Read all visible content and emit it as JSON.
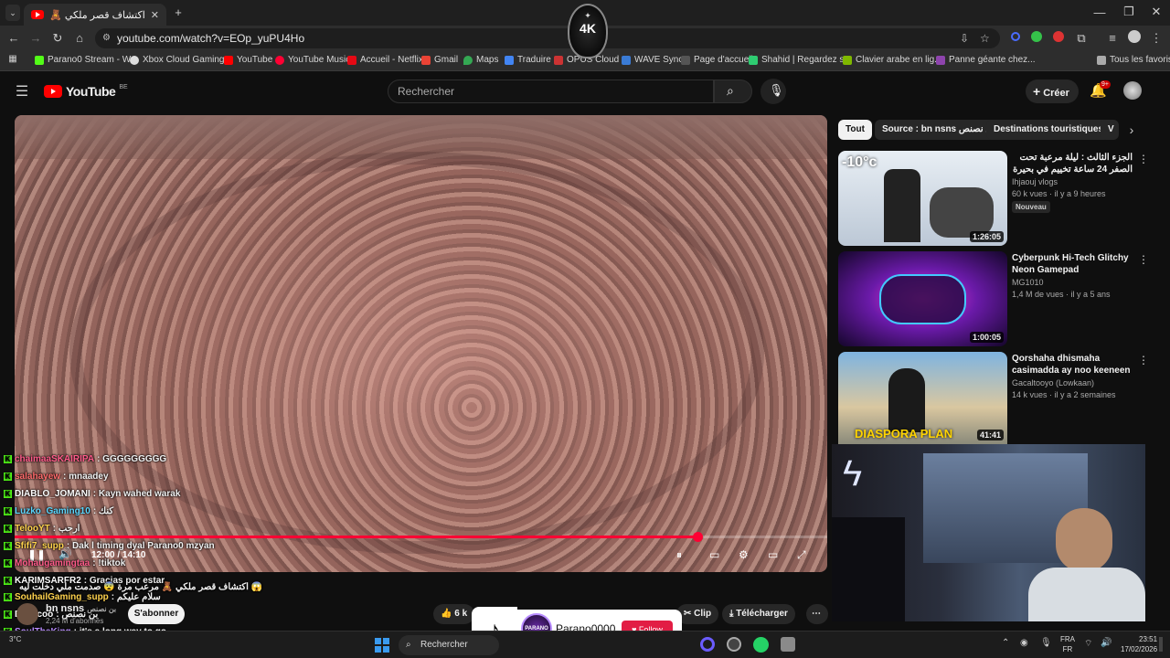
{
  "browser": {
    "tab_title": "اكتشاف قصر ملكي 🧸 (432) 🔊",
    "url": "youtube.com/watch?v=EOp_yuPU4Ho",
    "bookmarks": [
      "Parano0 Stream - W...",
      "Xbox Cloud Gaming...",
      "YouTube",
      "YouTube Music",
      "Accueil - Netflix",
      "Gmail",
      "Maps",
      "Traduire",
      "OPUS Cloud",
      "WAVE Sync",
      "Page d'accueil",
      "Shahid | Regardez s...",
      "Clavier arabe en lig...",
      "Panne géante chez..."
    ],
    "all_favorites": "Tous les favoris",
    "watermark": "4K"
  },
  "youtube": {
    "logo": "YouTube",
    "region": "BE",
    "search_placeholder": "Rechercher",
    "create_label": "Créer",
    "notif_count": "9+"
  },
  "player": {
    "progress": 0.84,
    "time": "12:00 / 14:10"
  },
  "chips": [
    "Tout",
    "Source : bn nsns بن نصنص",
    "Destinations touristiques",
    "V"
  ],
  "recommendations": [
    {
      "title": "الجزء الثالث : ليلة مرعبة تحت الصفر 24 ساعة تخييم في بحيرة صفيت ❄️",
      "channel": "Ihjaouj vlogs",
      "meta": "60 k vues · il y a 9 heures",
      "badge": "Nouveau",
      "duration": "1:26:05",
      "thumb_text": "-10°c"
    },
    {
      "title": "Cyberpunk Hi-Tech Glitchy Neon Gamepad Background ...",
      "channel": "MG1010",
      "meta": "1,4 M de vues · il y a 5 ans",
      "badge": "",
      "duration": "1:00:05",
      "thumb_text": ""
    },
    {
      "title": "Qorshaha dhismaha casimadda ay noo keeneen ...",
      "channel": "Gacaltooyo (Lowkaan)",
      "meta": "14 k vues · il y a 2 semaines",
      "badge": "",
      "duration": "41:41",
      "thumb_text": "DIASPORA PLAN"
    }
  ],
  "chat": [
    {
      "user": "chaimaaSKAIRIPA",
      "msg": ": GGGGGGGGG",
      "color": "#ff5b8a"
    },
    {
      "user": "salahayew",
      "msg": ": mnaadey",
      "color": "#ff6b6b"
    },
    {
      "user": "DIABLO_JOMANI",
      "msg": ": Kayn wahed warak",
      "color": "#ffffff"
    },
    {
      "user": "Luzko_Gaming10",
      "msg": ": كنك",
      "color": "#5bd7ff"
    },
    {
      "user": "TelooYT",
      "msg": ": ارحب",
      "color": "#ffd34d"
    },
    {
      "user": "Sfifi7_supp",
      "msg": ": Dak l timing dyal Parano0 mzyan",
      "color": "#ffd34d"
    },
    {
      "user": "Mohaugamingtaa",
      "msg": ": !tiktok",
      "color": "#ff5b8a"
    },
    {
      "user": "KARIMSARFR2",
      "msg": ": Gracias por estar",
      "color": "#ffffff"
    },
    {
      "user": "",
      "msg": "اكتشاف قصر ملكي 🧸 مرعب مرة 😨 صدمت ملي دخلت ليه 😱",
      "color": "#ffffff"
    },
    {
      "user": "SouhailGaming_supp",
      "msg": ": سلام عليكم",
      "color": "#ffd34d"
    },
    {
      "user": "Evettcoo",
      "msg": ": بن نصنص",
      "color": "#ffffff"
    },
    {
      "user": "SoulTheKing",
      "msg": ": it's a long way to go",
      "color": "#b98cff"
    },
    {
      "user": "AlliNChris",
      "msg": ": Lets go hbibi",
      "color": "#5bd7ff"
    }
  ],
  "channel": {
    "name": "bn nsns",
    "name_ar": "بن نصنص",
    "subs": "2,24 M d'abonnés",
    "subscribe": "S'abonner",
    "likes": "6 k",
    "clip": "Clip",
    "download": "Télécharger"
  },
  "tiktok": {
    "username": "Parano0000",
    "follow": "Follow",
    "avatar": "PARANO"
  },
  "taskbar": {
    "search": "Rechercher",
    "lang_top": "FRA",
    "lang_bottom": "FR",
    "time": "23:51",
    "date": "17/02/2026",
    "temp": "3°C"
  }
}
